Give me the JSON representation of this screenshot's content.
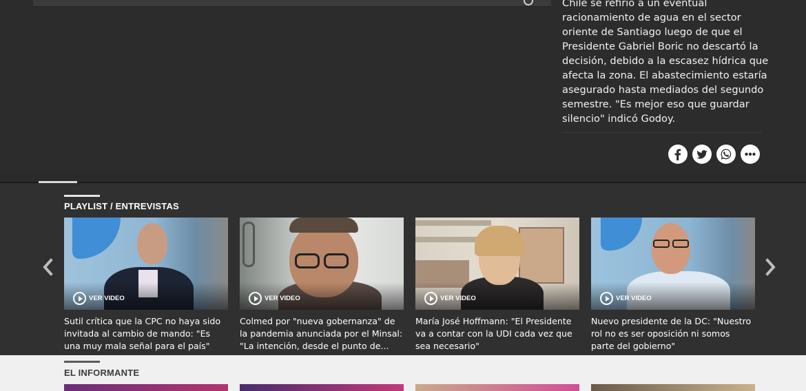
{
  "article": {
    "text": "Chile se refirió a un eventual racionamiento de agua en el sector oriente de Santiago luego de que el Presidente Gabriel Boric no descartó la decisión, debido a la escasez hídrica que afecta la zona. El abastecimiento estaría asegurado hasta mediados del segundo semestre. \"Es mejor eso que guardar silencio\" indicó Godoy."
  },
  "share": [
    {
      "icon": "facebook-icon"
    },
    {
      "icon": "twitter-icon"
    },
    {
      "icon": "whatsapp-icon"
    },
    {
      "icon": "more-icon"
    }
  ],
  "playlist": {
    "title": "PLAYLIST / ENTREVISTAS",
    "watch_label": "VER VIDEO",
    "items": [
      {
        "caption": "Sutil crítica que la CPC no haya sido invitada al cambio de mando: \"Es una muy mala señal para el país\""
      },
      {
        "caption": "Colmed por \"nueva gobernanza\" de la pandemia anunciada por el Minsal: \"La intención, desde el punto de..."
      },
      {
        "caption": "María José Hoffmann: \"El Presidente va a contar con la UDI cada vez que sea necesario\""
      },
      {
        "caption": "Nuevo presidente de la DC: \"Nuestro rol no es ser oposición ni somos parte del gobierno\""
      }
    ]
  },
  "informante": {
    "title": "EL INFORMANTE"
  },
  "colors": {
    "background": "#2e2e2e",
    "light_section": "#f0f0f0",
    "text": "#ffffff"
  }
}
